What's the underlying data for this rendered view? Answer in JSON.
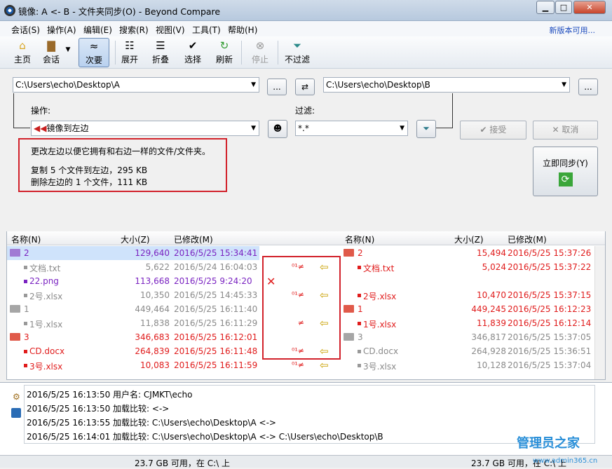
{
  "window": {
    "title": "镜像: A <- B - 文件夹同步(O) - Beyond Compare",
    "min": "▁",
    "max": "□",
    "close": "✕"
  },
  "menu": [
    "会话(S)",
    "操作(A)",
    "编辑(E)",
    "搜索(R)",
    "视图(V)",
    "工具(T)",
    "帮助(H)"
  ],
  "new_version": "新版本可用...",
  "toolbar": {
    "home": "主页",
    "sessions": "会话",
    "minor": "次要",
    "expand": "展开",
    "collapse": "折叠",
    "select": "选择",
    "refresh": "刷新",
    "stop": "停止",
    "nofilter": "不过滤"
  },
  "paths": {
    "left": "C:\\Users\\echo\\Desktop\\A",
    "right": "C:\\Users\\echo\\Desktop\\B",
    "browse": "..."
  },
  "operation": {
    "label": "操作:",
    "value": "镜像到左边"
  },
  "filter": {
    "label": "过滤:",
    "value": "*.*"
  },
  "buttons": {
    "accept": "接受",
    "cancel": "取消",
    "sync_now": "立即同步(Y)"
  },
  "summary": {
    "line1": "更改左边以便它拥有和右边一样的文件/文件夹。",
    "line2": "复制 5 个文件到左边，295 KB",
    "line3": "删除左边的 1 个文件，111 KB"
  },
  "columns": {
    "name": "名称(N)",
    "size": "大小(Z)",
    "modified": "已修改(M)"
  },
  "left_rows": [
    {
      "name": "2",
      "size": "129,640",
      "date": "2016/5/25 15:34:41",
      "type": "folder",
      "color": "purple",
      "indent": 0
    },
    {
      "name": "文档.txt",
      "size": "5,622",
      "date": "2016/5/24 16:04:03",
      "type": "file",
      "color": "gray",
      "indent": 1
    },
    {
      "name": "22.png",
      "size": "113,668",
      "date": "2016/5/25 9:24:20",
      "type": "file",
      "color": "purple",
      "indent": 1
    },
    {
      "name": "2号.xlsx",
      "size": "10,350",
      "date": "2016/5/25 14:45:33",
      "type": "file",
      "color": "gray",
      "indent": 1
    },
    {
      "name": "1",
      "size": "449,464",
      "date": "2016/5/25 16:11:40",
      "type": "folder",
      "color": "gray",
      "indent": 0
    },
    {
      "name": "1号.xlsx",
      "size": "11,838",
      "date": "2016/5/25 16:11:29",
      "type": "file",
      "color": "gray",
      "indent": 1
    },
    {
      "name": "3",
      "size": "346,683",
      "date": "2016/5/25 16:12:01",
      "type": "folder",
      "color": "red",
      "indent": 0
    },
    {
      "name": "CD.docx",
      "size": "264,839",
      "date": "2016/5/25 16:11:48",
      "type": "file",
      "color": "red",
      "indent": 1
    },
    {
      "name": "3号.xlsx",
      "size": "10,083",
      "date": "2016/5/25 16:11:59",
      "type": "file",
      "color": "red",
      "indent": 1
    }
  ],
  "right_rows": [
    {
      "name": "2",
      "size": "15,494",
      "date": "2016/5/25 15:37:26",
      "type": "folder",
      "color": "red",
      "indent": 0
    },
    {
      "name": "文档.txt",
      "size": "5,024",
      "date": "2016/5/25 15:37:22",
      "type": "file",
      "color": "red",
      "indent": 1
    },
    {
      "name": "",
      "size": "",
      "date": "",
      "type": "empty",
      "color": "gray",
      "indent": 1
    },
    {
      "name": "2号.xlsx",
      "size": "10,470",
      "date": "2016/5/25 15:37:15",
      "type": "file",
      "color": "red",
      "indent": 1
    },
    {
      "name": "1",
      "size": "449,245",
      "date": "2016/5/25 16:12:23",
      "type": "folder",
      "color": "red",
      "indent": 0
    },
    {
      "name": "1号.xlsx",
      "size": "11,839",
      "date": "2016/5/25 16:12:14",
      "type": "file",
      "color": "red",
      "indent": 1
    },
    {
      "name": "3",
      "size": "346,817",
      "date": "2016/5/25 15:37:05",
      "type": "folder",
      "color": "gray",
      "indent": 0
    },
    {
      "name": "CD.docx",
      "size": "264,928",
      "date": "2016/5/25 15:36:51",
      "type": "file",
      "color": "gray",
      "indent": 1
    },
    {
      "name": "3号.xlsx",
      "size": "10,128",
      "date": "2016/5/25 15:37:04",
      "type": "file",
      "color": "gray",
      "indent": 1
    }
  ],
  "actions": [
    {
      "del": "",
      "rel": "",
      "arrow": ""
    },
    {
      "del": "",
      "rel": "⁰¹≠",
      "arrow": "⇦"
    },
    {
      "del": "✕",
      "rel": "",
      "arrow": ""
    },
    {
      "del": "",
      "rel": "⁰¹≠",
      "arrow": "⇦"
    },
    {
      "del": "",
      "rel": "",
      "arrow": ""
    },
    {
      "del": "",
      "rel": "≠",
      "arrow": "⇦"
    },
    {
      "del": "",
      "rel": "",
      "arrow": ""
    },
    {
      "del": "",
      "rel": "⁰¹≠",
      "arrow": "⇦"
    },
    {
      "del": "",
      "rel": "⁰¹≠",
      "arrow": "⇦"
    }
  ],
  "log": [
    "2016/5/25 16:13:50  用户名: CJMKT\\echo",
    "2016/5/25 16:13:50  加载比较: <->",
    "2016/5/25 16:13:55  加载比较: C:\\Users\\echo\\Desktop\\A <->",
    "2016/5/25 16:14:01  加载比较: C:\\Users\\echo\\Desktop\\A <-> C:\\Users\\echo\\Desktop\\B"
  ],
  "status": {
    "left": "23.7 GB 可用，在 C:\\ 上",
    "right": "23.7 GB 可用，在 C:\\ 上"
  },
  "watermark": {
    "brand": "管理员之家",
    "url": "www.admin365.cn"
  }
}
